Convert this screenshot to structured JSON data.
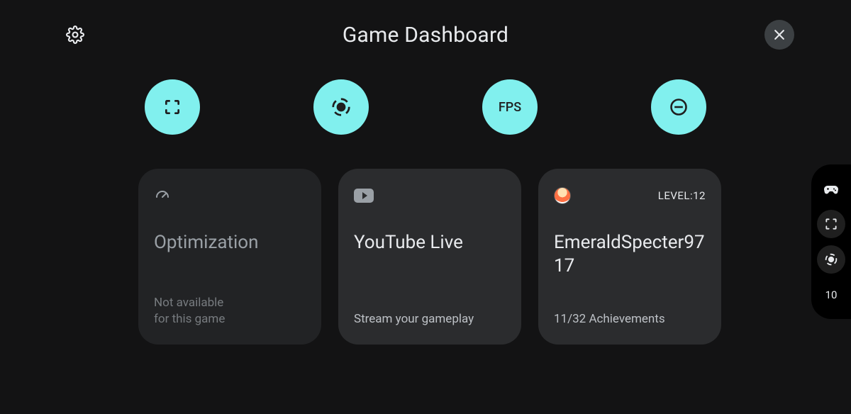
{
  "header": {
    "title": "Game Dashboard"
  },
  "actions": {
    "fps_label": "FPS"
  },
  "cards": {
    "optimization": {
      "title": "Optimization",
      "subtitle": "Not available\nfor this game"
    },
    "youtube": {
      "title": "YouTube Live",
      "subtitle": "Stream your gameplay"
    },
    "profile": {
      "level_label": "LEVEL:12",
      "username": "EmeraldSpecter9717",
      "achievements": "11/32 Achievements"
    }
  },
  "sidepill": {
    "fps_value": "10"
  }
}
